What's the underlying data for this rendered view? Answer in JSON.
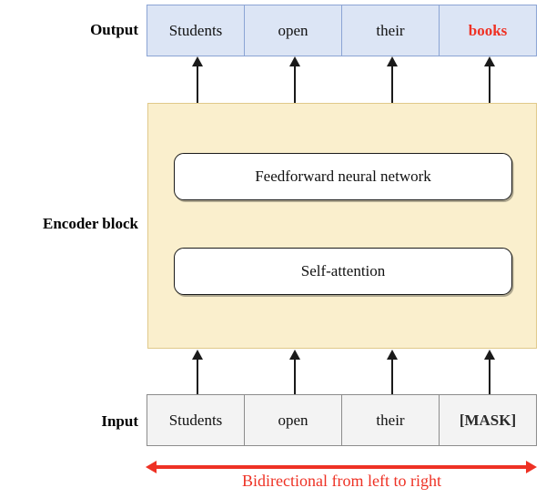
{
  "diagram": {
    "title": "BERT bidirectional encoder block diagram",
    "colors": {
      "output_fill": "#dce5f5",
      "output_border": "#8ba4d4",
      "input_fill": "#f3f3f3",
      "input_border": "#8c8c8c",
      "encoder_fill": "#faefcd",
      "encoder_border": "#e0c98a",
      "accent_red": "#ee3124",
      "arrow_black": "#1a1a1a"
    }
  },
  "labels": {
    "output": "Output",
    "encoder": "Encoder  block",
    "input": "Input"
  },
  "output_row": {
    "tokens": [
      {
        "text": "Students",
        "style": "normal"
      },
      {
        "text": "open",
        "style": "normal"
      },
      {
        "text": "their",
        "style": "normal"
      },
      {
        "text": "books",
        "style": "highlight"
      }
    ]
  },
  "input_row": {
    "tokens": [
      {
        "text": "Students",
        "style": "normal"
      },
      {
        "text": "open",
        "style": "normal"
      },
      {
        "text": "their",
        "style": "normal"
      },
      {
        "text": "[MASK]",
        "style": "mask"
      }
    ]
  },
  "encoder_block": {
    "layers": [
      {
        "text": "Feedforward neural network"
      },
      {
        "text": "Self-attention"
      }
    ]
  },
  "bidirectional": {
    "caption": "Bidirectional from left to right",
    "icon": "double-headed-arrow-icon"
  },
  "arrows": {
    "top_count": 4,
    "bottom_count": 4,
    "direction": "up",
    "icon": "arrow-up-icon"
  }
}
